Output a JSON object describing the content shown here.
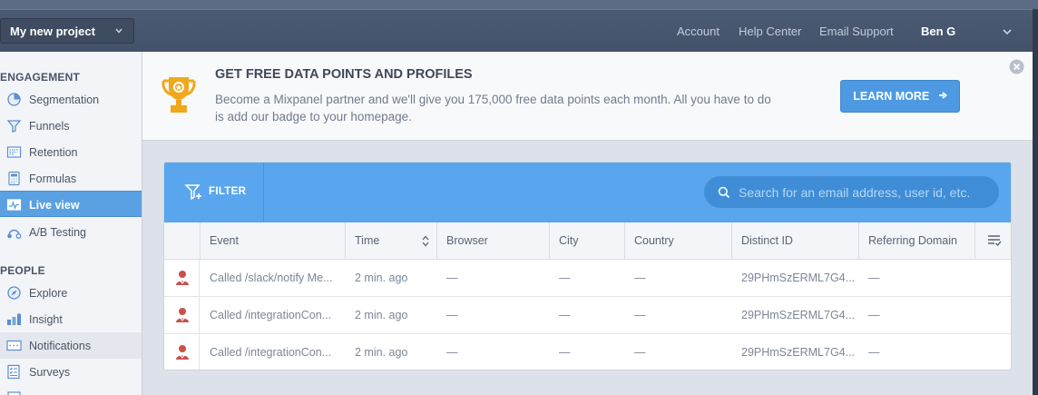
{
  "header": {
    "project": "My new project",
    "links": [
      "Account",
      "Help Center",
      "Email Support"
    ],
    "user": "Ben G"
  },
  "sidebar": {
    "sections": [
      {
        "title": "ENGAGEMENT",
        "items": [
          {
            "label": "Segmentation",
            "icon": "pie-chart-icon"
          },
          {
            "label": "Funnels",
            "icon": "funnel-icon"
          },
          {
            "label": "Retention",
            "icon": "retention-grid-icon"
          },
          {
            "label": "Formulas",
            "icon": "calculator-icon"
          },
          {
            "label": "Live view",
            "icon": "live-view-icon",
            "active": true
          },
          {
            "label": "A/B Testing",
            "icon": "ab-testing-icon"
          }
        ]
      },
      {
        "title": "PEOPLE",
        "items": [
          {
            "label": "Explore",
            "icon": "explore-icon"
          },
          {
            "label": "Insight",
            "icon": "insight-bars-icon"
          },
          {
            "label": "Notifications",
            "icon": "notifications-icon"
          },
          {
            "label": "Surveys",
            "icon": "survey-icon"
          }
        ]
      }
    ]
  },
  "banner": {
    "title": "GET FREE DATA POINTS AND PROFILES",
    "text": "Become a Mixpanel partner and we'll give you 175,000 free data points each month. All you have to do is add our badge to your homepage.",
    "button": "LEARN MORE"
  },
  "toolbar": {
    "filter_label": "FILTER",
    "search_placeholder": "Search for an email address, user id, etc."
  },
  "table": {
    "columns": [
      "Event",
      "Time",
      "Browser",
      "City",
      "Country",
      "Distinct ID",
      "Referring Domain"
    ],
    "rows": [
      [
        "Called /slack/notify Me...",
        "2 min. ago",
        "—",
        "—",
        "—",
        "29PHmSzERML7G4...",
        "—"
      ],
      [
        "Called /integrationCon...",
        "2 min. ago",
        "—",
        "—",
        "—",
        "29PHmSzERML7G4...",
        "—"
      ],
      [
        "Called /integrationCon...",
        "2 min. ago",
        "—",
        "—",
        "—",
        "29PHmSzERML7G4...",
        "—"
      ]
    ]
  },
  "colors": {
    "accent": "#5aa6ee",
    "header": "#4c5b74",
    "active_nav": "#5aa1e3",
    "trophy": "#f0a81c",
    "avatar": "#c9504a"
  }
}
